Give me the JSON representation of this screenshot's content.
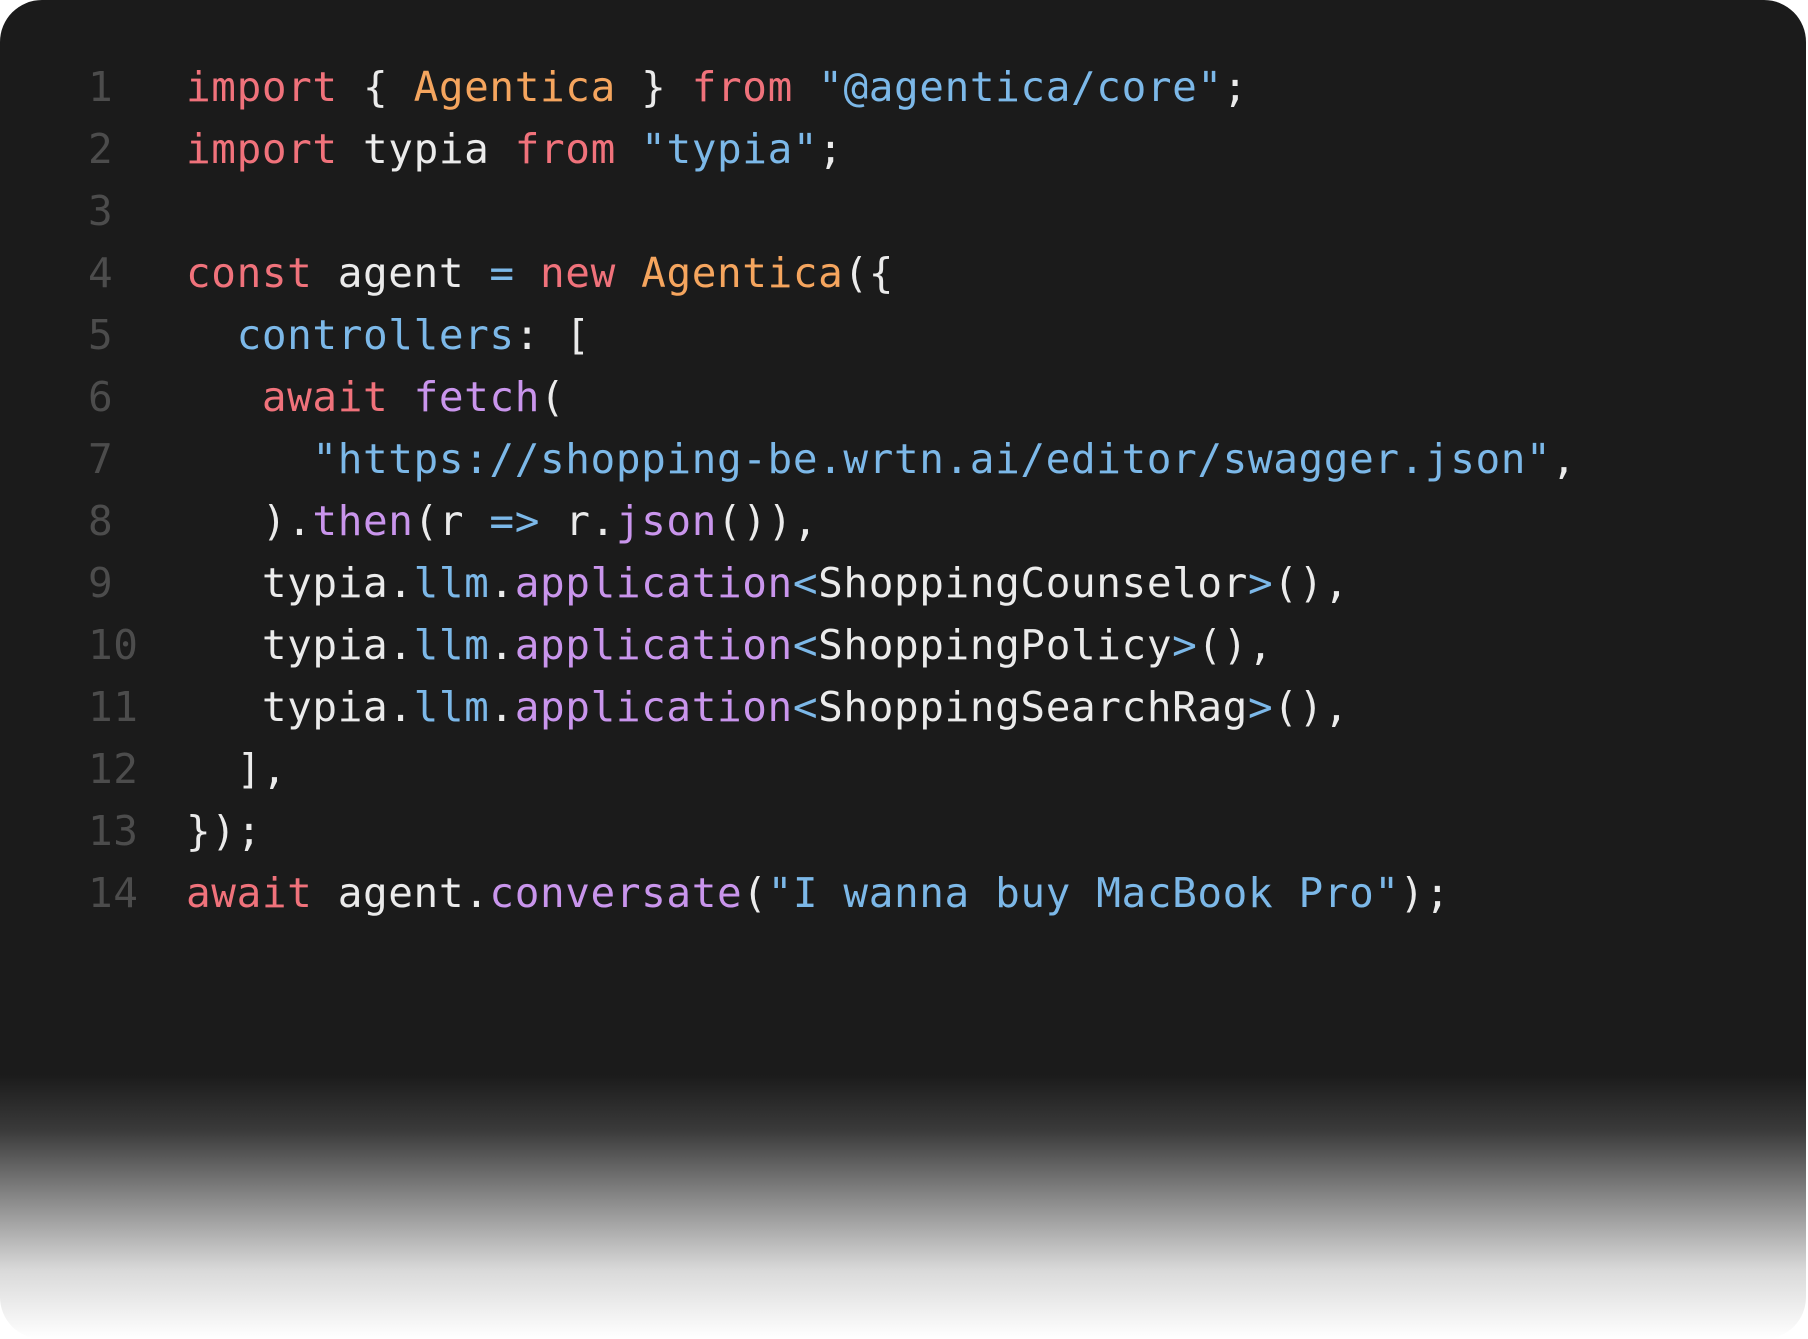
{
  "code": {
    "lines": [
      {
        "number": "1",
        "tokens": [
          {
            "text": "import",
            "kind": "kw"
          },
          {
            "text": " { ",
            "kind": "pun"
          },
          {
            "text": "Agentica",
            "kind": "cls"
          },
          {
            "text": " } ",
            "kind": "pun"
          },
          {
            "text": "from",
            "kind": "kw"
          },
          {
            "text": " ",
            "kind": "pun"
          },
          {
            "text": "\"@agentica/core\"",
            "kind": "str"
          },
          {
            "text": ";",
            "kind": "pun"
          }
        ]
      },
      {
        "number": "2",
        "tokens": [
          {
            "text": "import",
            "kind": "kw"
          },
          {
            "text": " typia ",
            "kind": "id"
          },
          {
            "text": "from",
            "kind": "kw"
          },
          {
            "text": " ",
            "kind": "pun"
          },
          {
            "text": "\"typia\"",
            "kind": "str"
          },
          {
            "text": ";",
            "kind": "pun"
          }
        ]
      },
      {
        "number": "3",
        "tokens": []
      },
      {
        "number": "4",
        "tokens": [
          {
            "text": "const",
            "kind": "kw"
          },
          {
            "text": " agent ",
            "kind": "id"
          },
          {
            "text": "=",
            "kind": "op"
          },
          {
            "text": " ",
            "kind": "pun"
          },
          {
            "text": "new",
            "kind": "kw"
          },
          {
            "text": " ",
            "kind": "pun"
          },
          {
            "text": "Agentica",
            "kind": "cls"
          },
          {
            "text": "({",
            "kind": "pun"
          }
        ]
      },
      {
        "number": "5",
        "tokens": [
          {
            "text": "  ",
            "kind": "pun"
          },
          {
            "text": "controllers",
            "kind": "prop"
          },
          {
            "text": ": [",
            "kind": "pun"
          }
        ]
      },
      {
        "number": "6",
        "tokens": [
          {
            "text": "   ",
            "kind": "pun"
          },
          {
            "text": "await",
            "kind": "kw"
          },
          {
            "text": " ",
            "kind": "pun"
          },
          {
            "text": "fetch",
            "kind": "fn"
          },
          {
            "text": "(",
            "kind": "pun"
          }
        ]
      },
      {
        "number": "7",
        "tokens": [
          {
            "text": "     ",
            "kind": "pun"
          },
          {
            "text": "\"https://shopping-be.wrtn.ai/editor/swagger.json\"",
            "kind": "str"
          },
          {
            "text": ",",
            "kind": "pun"
          }
        ]
      },
      {
        "number": "8",
        "tokens": [
          {
            "text": "   ).",
            "kind": "pun"
          },
          {
            "text": "then",
            "kind": "fn"
          },
          {
            "text": "(r ",
            "kind": "id"
          },
          {
            "text": "=>",
            "kind": "op"
          },
          {
            "text": " r.",
            "kind": "id"
          },
          {
            "text": "json",
            "kind": "fn"
          },
          {
            "text": "()),",
            "kind": "pun"
          }
        ]
      },
      {
        "number": "9",
        "tokens": [
          {
            "text": "   typia.",
            "kind": "id"
          },
          {
            "text": "llm",
            "kind": "prop"
          },
          {
            "text": ".",
            "kind": "pun"
          },
          {
            "text": "application",
            "kind": "fn"
          },
          {
            "text": "<",
            "kind": "op"
          },
          {
            "text": "ShoppingCounselor",
            "kind": "id"
          },
          {
            "text": ">",
            "kind": "op"
          },
          {
            "text": "(),",
            "kind": "pun"
          }
        ]
      },
      {
        "number": "10",
        "tokens": [
          {
            "text": "   typia.",
            "kind": "id"
          },
          {
            "text": "llm",
            "kind": "prop"
          },
          {
            "text": ".",
            "kind": "pun"
          },
          {
            "text": "application",
            "kind": "fn"
          },
          {
            "text": "<",
            "kind": "op"
          },
          {
            "text": "ShoppingPolicy",
            "kind": "id"
          },
          {
            "text": ">",
            "kind": "op"
          },
          {
            "text": "(),",
            "kind": "pun"
          }
        ]
      },
      {
        "number": "11",
        "tokens": [
          {
            "text": "   typia.",
            "kind": "id"
          },
          {
            "text": "llm",
            "kind": "prop"
          },
          {
            "text": ".",
            "kind": "pun"
          },
          {
            "text": "application",
            "kind": "fn"
          },
          {
            "text": "<",
            "kind": "op"
          },
          {
            "text": "ShoppingSearchRag",
            "kind": "id"
          },
          {
            "text": ">",
            "kind": "op"
          },
          {
            "text": "(),",
            "kind": "pun"
          }
        ]
      },
      {
        "number": "12",
        "tokens": [
          {
            "text": "  ],",
            "kind": "pun"
          }
        ]
      },
      {
        "number": "13",
        "tokens": [
          {
            "text": "});",
            "kind": "pun"
          }
        ]
      },
      {
        "number": "14",
        "tokens": [
          {
            "text": "await",
            "kind": "kw"
          },
          {
            "text": " agent.",
            "kind": "id"
          },
          {
            "text": "conversate",
            "kind": "fn"
          },
          {
            "text": "(",
            "kind": "pun"
          },
          {
            "text": "\"I wanna buy MacBook Pro\"",
            "kind": "str"
          },
          {
            "text": ");",
            "kind": "pun"
          }
        ]
      }
    ]
  },
  "theme": {
    "background": "#1b1b1b",
    "keyword": "#f0727b",
    "class": "#f5a55e",
    "string": "#7cb8e8",
    "function": "#c995ec",
    "text": "#ebebeb",
    "line_number": "#4c4c4c"
  }
}
